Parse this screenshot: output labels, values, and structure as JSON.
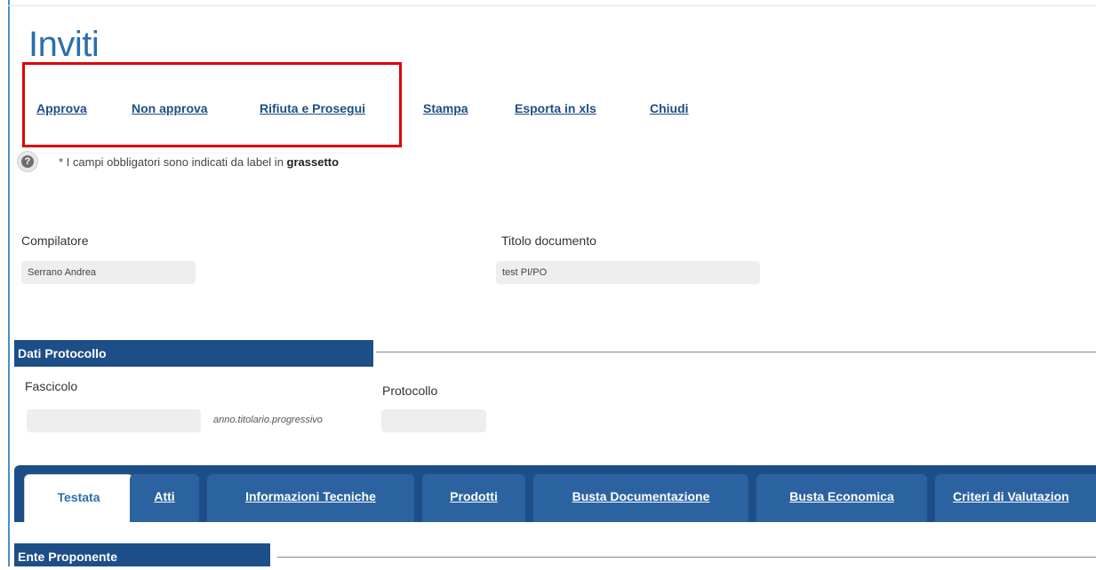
{
  "page": {
    "title": "Inviti"
  },
  "toolbar": {
    "items": [
      {
        "label": "Approva"
      },
      {
        "label": "Non approva"
      },
      {
        "label": "Rifiuta e Prosegui"
      },
      {
        "label": "Stampa"
      },
      {
        "label": "Esporta in xls"
      },
      {
        "label": "Chiudi"
      }
    ]
  },
  "note": {
    "prefix": "* I campi obbligatori sono indicati da label in ",
    "bold": "grassetto"
  },
  "help_icon": {
    "glyph": "?"
  },
  "form": {
    "compilatore_label": "Compilatore",
    "compilatore_value": "Serrano Andrea",
    "titolo_label": "Titolo documento",
    "titolo_value": "test PI/PO"
  },
  "protocollo_section": {
    "header": "Dati Protocollo",
    "fascicolo_label": "Fascicolo",
    "fascicolo_value": "",
    "fascicolo_hint": "anno.titolario.progressivo",
    "protocollo_label": "Protocollo",
    "protocollo_value": ""
  },
  "tabs": [
    {
      "label": "Testata",
      "active": true
    },
    {
      "label": "Atti"
    },
    {
      "label": "Informazioni Tecniche"
    },
    {
      "label": "Prodotti"
    },
    {
      "label": "Busta Documentazione"
    },
    {
      "label": "Busta Economica"
    },
    {
      "label": "Criteri di Valutazion"
    }
  ],
  "ente_section": {
    "header": "Ente Proponente"
  },
  "colors": {
    "primary": "#1d4e87",
    "tab": "#2b63a0",
    "link": "#1f4e84",
    "title": "#2a6fb0",
    "highlight": "#e00000"
  }
}
